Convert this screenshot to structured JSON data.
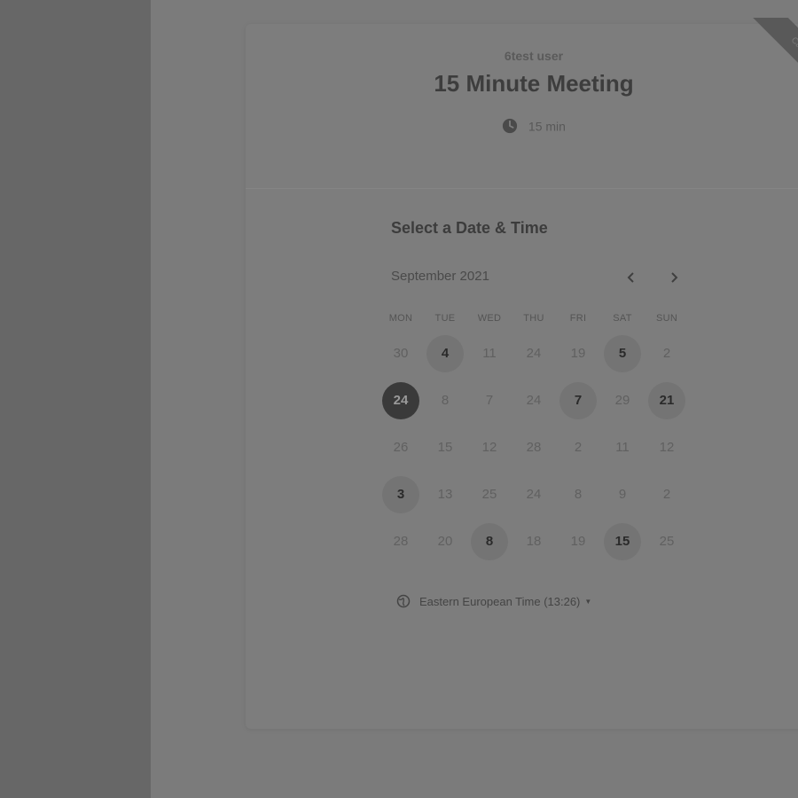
{
  "event": {
    "owner": "6test user",
    "title": "15 Minute Meeting",
    "duration": "15 min",
    "ribbon_text": "Calendly"
  },
  "calendar": {
    "heading": "Select a Date & Time",
    "month": "September 2021",
    "prev_icon": "chevron-left-icon",
    "next_icon": "chevron-right-icon",
    "weekdays": [
      "MON",
      "TUE",
      "WED",
      "THU",
      "FRI",
      "SAT",
      "SUN"
    ],
    "weeks": [
      [
        {
          "label": "30",
          "state": "disabled"
        },
        {
          "label": "4",
          "state": "available"
        },
        {
          "label": "11",
          "state": "disabled"
        },
        {
          "label": "24",
          "state": "disabled"
        },
        {
          "label": "19",
          "state": "disabled"
        },
        {
          "label": "5",
          "state": "available"
        },
        {
          "label": "2",
          "state": "disabled"
        }
      ],
      [
        {
          "label": "24",
          "state": "selected"
        },
        {
          "label": "8",
          "state": "disabled"
        },
        {
          "label": "7",
          "state": "disabled"
        },
        {
          "label": "24",
          "state": "disabled"
        },
        {
          "label": "7",
          "state": "available"
        },
        {
          "label": "29",
          "state": "disabled"
        },
        {
          "label": "21",
          "state": "available"
        }
      ],
      [
        {
          "label": "26",
          "state": "disabled"
        },
        {
          "label": "15",
          "state": "disabled"
        },
        {
          "label": "12",
          "state": "disabled"
        },
        {
          "label": "28",
          "state": "disabled"
        },
        {
          "label": "2",
          "state": "disabled"
        },
        {
          "label": "11",
          "state": "disabled"
        },
        {
          "label": "12",
          "state": "disabled"
        }
      ],
      [
        {
          "label": "3",
          "state": "available"
        },
        {
          "label": "13",
          "state": "disabled"
        },
        {
          "label": "25",
          "state": "disabled"
        },
        {
          "label": "24",
          "state": "disabled"
        },
        {
          "label": "8",
          "state": "disabled"
        },
        {
          "label": "9",
          "state": "disabled"
        },
        {
          "label": "2",
          "state": "disabled"
        }
      ],
      [
        {
          "label": "28",
          "state": "disabled"
        },
        {
          "label": "20",
          "state": "disabled"
        },
        {
          "label": "8",
          "state": "available"
        },
        {
          "label": "18",
          "state": "disabled"
        },
        {
          "label": "19",
          "state": "disabled"
        },
        {
          "label": "15",
          "state": "available"
        },
        {
          "label": "25",
          "state": "disabled"
        }
      ]
    ],
    "timezone": "Eastern European Time (13:26)"
  },
  "colors": {
    "overlay": "#7b7b7b",
    "left_panel": "#676767",
    "selected_day": "#3a3a3a",
    "available_day": "#747474"
  }
}
